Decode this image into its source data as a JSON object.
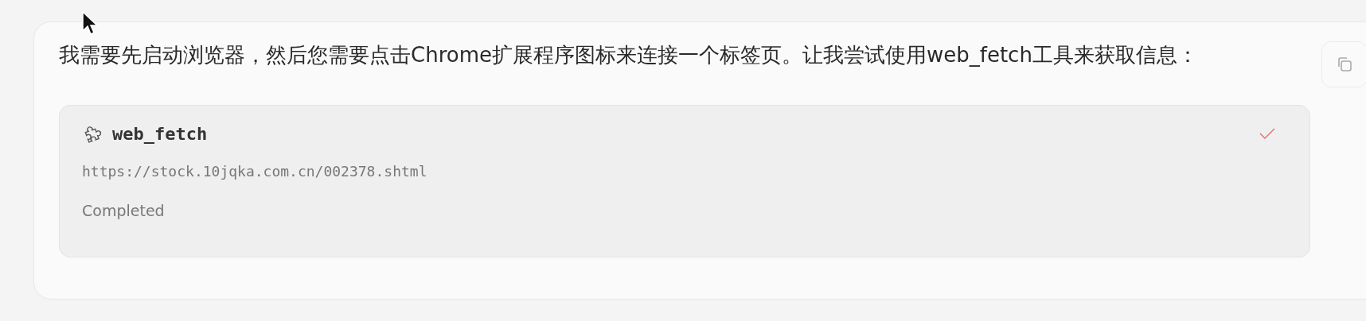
{
  "message": {
    "text": "我需要先启动浏览器，然后您需要点击Chrome扩展程序图标来连接一个标签页。让我尝试使用web_fetch工具来获取信息："
  },
  "tool_call": {
    "name": "web_fetch",
    "url": "https://stock.10jqka.com.cn/002378.shtml",
    "status": "Completed",
    "done": true
  }
}
